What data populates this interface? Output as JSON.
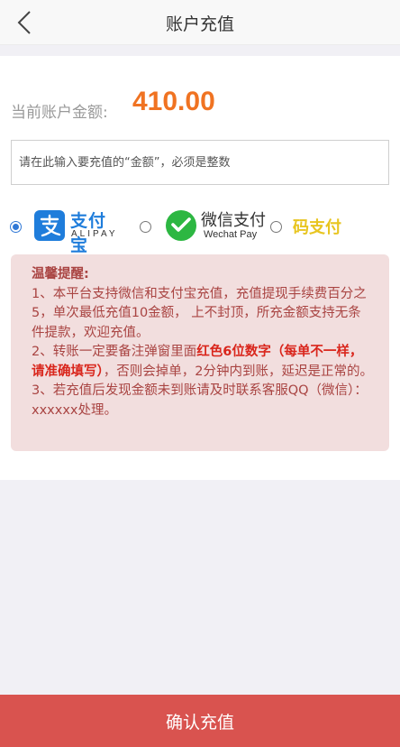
{
  "header": {
    "title": "账户充值",
    "back_icon": "chevron-left-icon"
  },
  "balance": {
    "label": "当前账户金额:",
    "value": "410.00"
  },
  "amount_input": {
    "placeholder": "请在此输入要充值的“金额”，必须是整数",
    "value": ""
  },
  "payment_methods": {
    "selected": "alipay",
    "alipay": {
      "name_cn": "支付宝",
      "name_en": "ALIPAY"
    },
    "wechat": {
      "name_cn": "微信支付",
      "name_en": "Wechat Pay"
    },
    "code": {
      "label": "码支付"
    }
  },
  "notice": {
    "title": "温馨提醒:",
    "item1": "1、本平台支持微信和支付宝充值，充值提现手续费百分之5，单次最低充值10金额， 上不封顶，所充金额支持无条件提款，欢迎充值。",
    "item2_pre": "2、转账一定要备注弹窗里面",
    "item2_highlight": "红色6位数字（每单不一样，请准确填写）",
    "item2_post": "，否则会掉单，2分钟内到账，延迟是正常的。",
    "item3": "3、若充值后发现金额未到账请及时联系客服QQ（微信）：xxxxxx处理。"
  },
  "confirm_button": {
    "label": "确认充值"
  },
  "colors": {
    "balance": "#f07322",
    "alipay": "#1f7ddb",
    "wechat": "#2db742",
    "code_pay": "#e8c520",
    "notice_bg": "#f2dede",
    "notice_text": "#a94442",
    "highlight": "#d9261c",
    "button": "#d9534f"
  }
}
